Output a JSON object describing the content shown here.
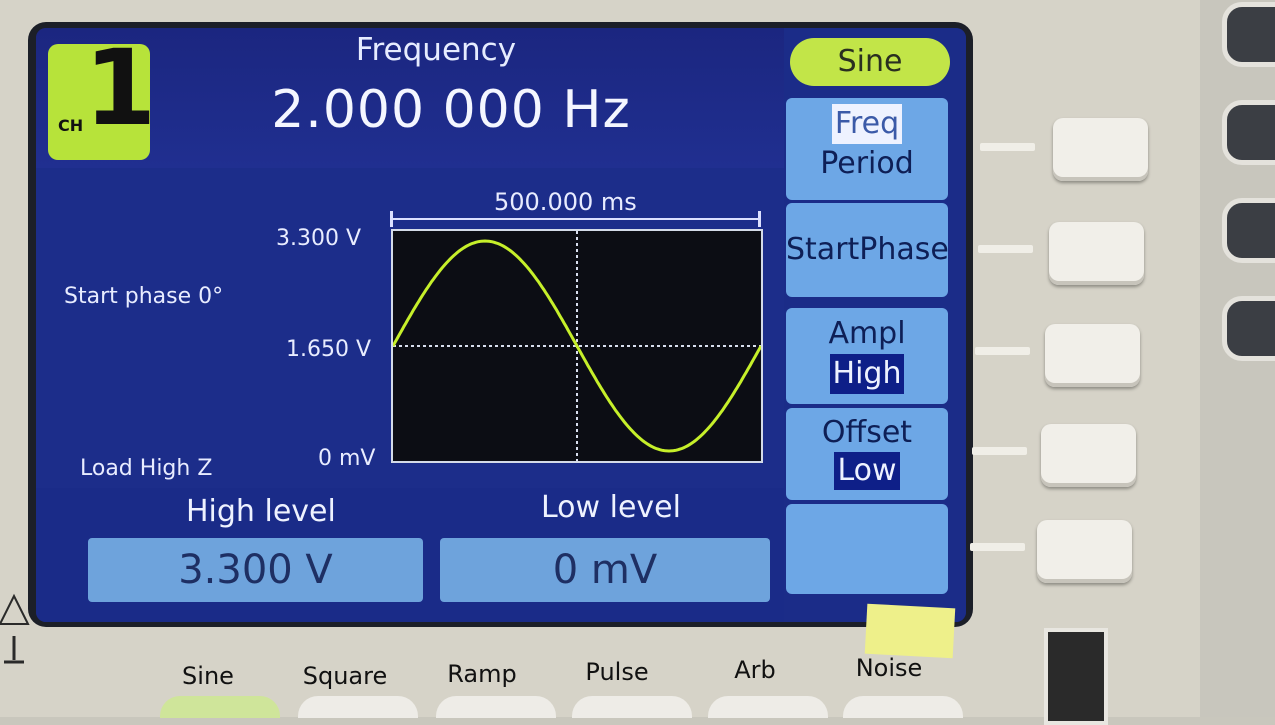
{
  "channel": {
    "number": "1",
    "prefix": "CH"
  },
  "frequency": {
    "title": "Frequency",
    "value": "2.000 000 Hz"
  },
  "timebase": "500.000 ms",
  "waveform": {
    "y_labels": {
      "top": "3.300 V",
      "mid": "1.650 V",
      "bottom": "0 mV"
    },
    "start_phase": "Start phase 0°",
    "load": "Load High Z"
  },
  "levels": {
    "high_label": "High level",
    "high_value": "3.300 V",
    "low_label": "Low level",
    "low_value": "0 mV"
  },
  "softkeys": {
    "mode": "Sine",
    "freq": "Freq",
    "period": "Period",
    "start_phase": "StartPhase",
    "ampl": "Ampl",
    "ampl_sel": "High",
    "offset": "Offset",
    "offset_sel": "Low"
  },
  "function_buttons": [
    "Sine",
    "Square",
    "Ramp",
    "Pulse",
    "Arb",
    "Noise"
  ],
  "colors": {
    "screen": "#1a2c86",
    "trace": "#c6ef2a",
    "badge": "#b7e33a",
    "softkey": "#6da7e6"
  }
}
